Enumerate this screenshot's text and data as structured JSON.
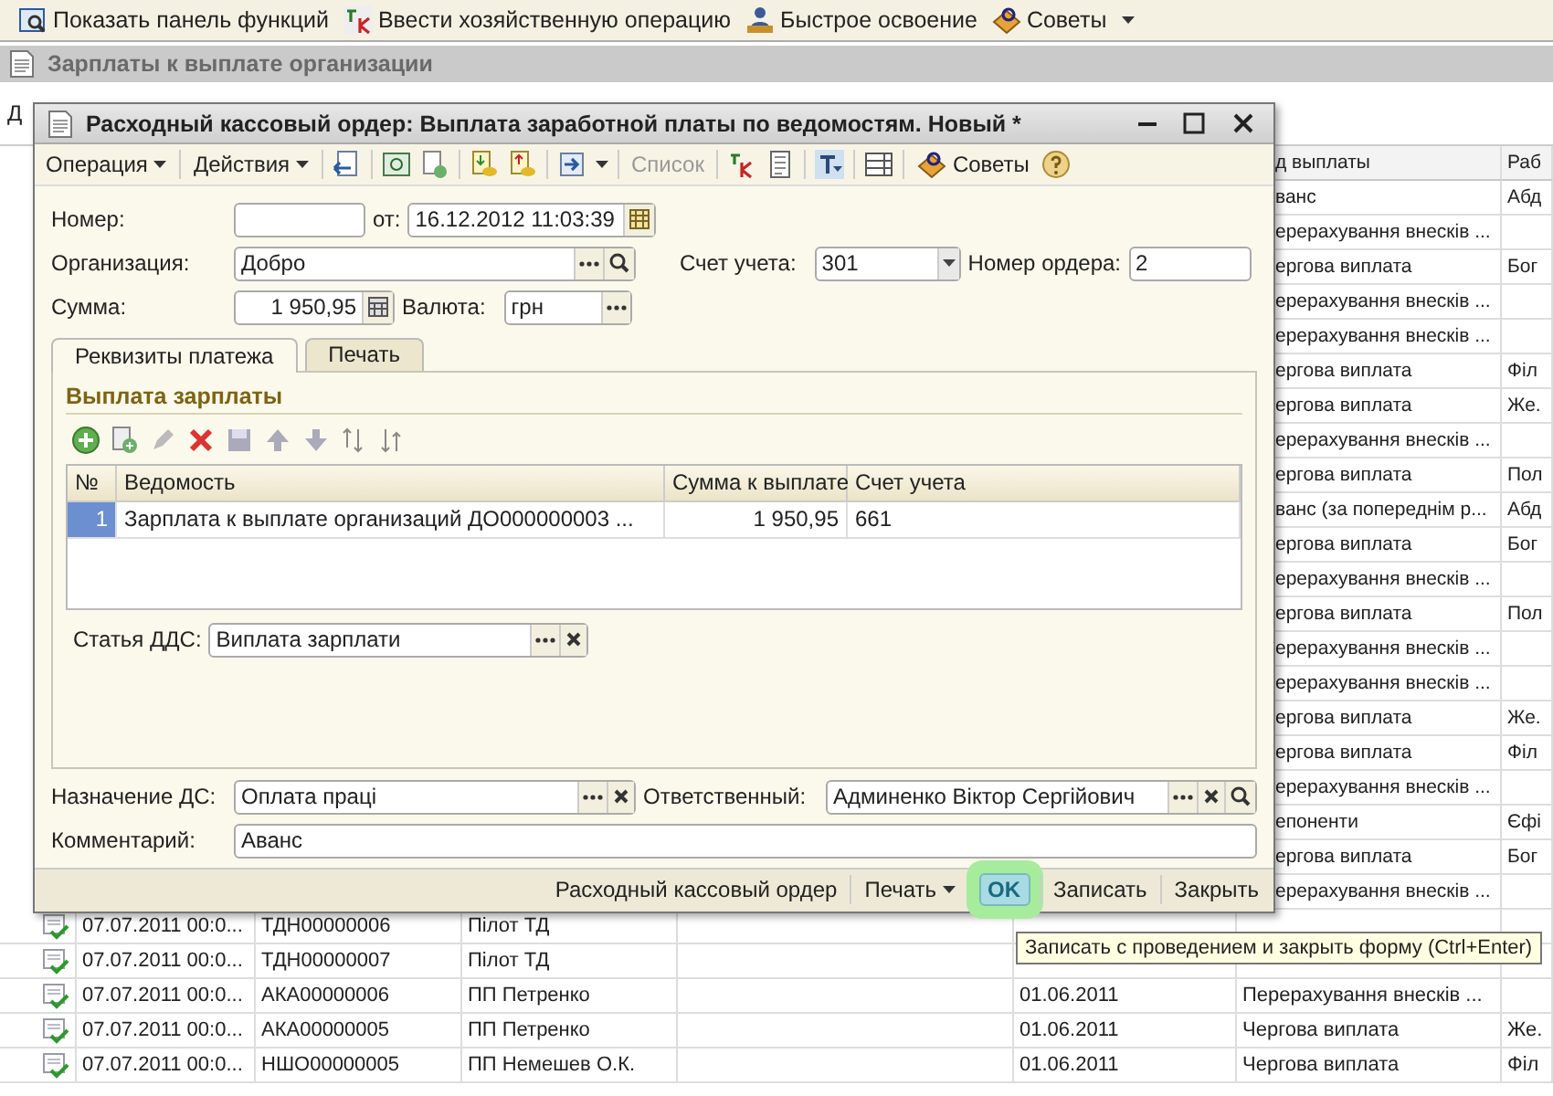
{
  "app_toolbar": {
    "items": [
      {
        "label": "Показать панель функций"
      },
      {
        "label": "Ввести хозяйственную операцию"
      },
      {
        "label": "Быстрое освоение"
      },
      {
        "label": "Советы"
      }
    ]
  },
  "list_window": {
    "title": "Зарплаты к выплате организации",
    "toolbar_text": "Д",
    "side_columns": [
      "д выплаты",
      "Раб"
    ],
    "side_rows": [
      [
        "ванс",
        "Абд"
      ],
      [
        "ерерахування внесків ..."
      ],
      [
        "ергова виплата",
        "Бог"
      ],
      [
        "ерерахування внесків ..."
      ],
      [
        "ерерахування внесків ..."
      ],
      [
        "ергова виплата",
        "Філ"
      ],
      [
        "ергова виплата",
        "Же."
      ],
      [
        "ерерахування внесків ..."
      ],
      [
        "ергова виплата",
        "Пол"
      ],
      [
        "ванс (за попереднім р...",
        "Абд"
      ],
      [
        "ергова виплата",
        "Бог"
      ],
      [
        "ерерахування внесків ..."
      ],
      [
        "ергова виплата",
        "Пол"
      ],
      [
        "ерерахування внесків ..."
      ],
      [
        "ерерахування внесків ..."
      ],
      [
        "ергова виплата",
        "Же."
      ],
      [
        "ергова виплата",
        "Філ"
      ],
      [
        "ерерахування внесків ..."
      ],
      [
        "епоненти",
        "Єфі"
      ],
      [
        "ергова виплата",
        "Бог"
      ],
      [
        "ерерахування внесків ..."
      ]
    ],
    "rows": [
      {
        "date": "07.07.2011 00:0...",
        "number": "ТДН00000006",
        "organization": "Пілот ТД"
      },
      {
        "date": "07.07.2011 00:0...",
        "number": "ТДН00000007",
        "organization": "Пілот ТД"
      },
      {
        "date": "07.07.2011 00:0...",
        "number": "АКА00000006",
        "organization": "ПП Петренко",
        "period": "01.06.2011",
        "payment_type": "Перерахування внесків ..."
      },
      {
        "date": "07.07.2011 00:0...",
        "number": "АКА00000005",
        "organization": "ПП Петренко",
        "period": "01.06.2011",
        "payment_type": "Чергова виплата",
        "employee": "Же."
      },
      {
        "date": "07.07.2011 00:0...",
        "number": "НШО00000005",
        "organization": "ПП Немешев О.К.",
        "period": "01.06.2011",
        "payment_type": "Чергова виплата",
        "employee": "Філ"
      }
    ]
  },
  "dialog": {
    "title": "Расходный кассовый ордер: Выплата заработной платы по ведомостям. Новый *",
    "toolbar": {
      "operation_menu": "Операция",
      "actions_menu": "Действия",
      "list_button": {
        "label": "Список",
        "disabled": true
      },
      "tips_button": "Советы"
    },
    "number": {
      "label": "Номер:"
    },
    "date": {
      "label": "от:",
      "value": "16.12.2012 11:03:39"
    },
    "organization": {
      "label": "Организация:",
      "value": "Добро"
    },
    "account": {
      "label": "Счет учета:",
      "value": "301"
    },
    "order_number": {
      "label": "Номер ордера:",
      "value": "2"
    },
    "amount": {
      "label": "Сумма:",
      "value": "1 950,95"
    },
    "currency": {
      "label": "Валюта:",
      "value": "грн"
    },
    "tabs": [
      {
        "label": "Реквизиты платежа",
        "selected": true
      },
      {
        "label": "Печать",
        "selected": false
      }
    ],
    "group_title": "Выплата зарплаты",
    "table": {
      "columns": [
        "№",
        "Ведомость",
        "Сумма к выплате",
        "Счет учета"
      ],
      "rows": [
        {
          "cells": [
            "1",
            "Зарплата к выплате организаций ДО000000003 ...",
            "1 950,95",
            "661"
          ],
          "selected": true
        }
      ]
    },
    "cash_flow_item": {
      "label": "Статья ДДС:",
      "value": "Виплата зарплати"
    },
    "purpose": {
      "label": "Назначение ДС:",
      "value": "Оплата праці"
    },
    "responsible": {
      "label": "Ответственный:",
      "value": "Админенко Віктор Сергійович"
    },
    "comment": {
      "label": "Комментарий:",
      "value": "Аванс"
    },
    "footer": {
      "document_link": "Расходный кассовый ордер",
      "print_menu": "Печать",
      "ok_button": {
        "label": "OK",
        "highlighted": true
      },
      "save_button": "Записать",
      "close_button": "Закрыть"
    }
  },
  "tooltip": "Записать с проведением и закрыть форму (Ctrl+Enter)"
}
